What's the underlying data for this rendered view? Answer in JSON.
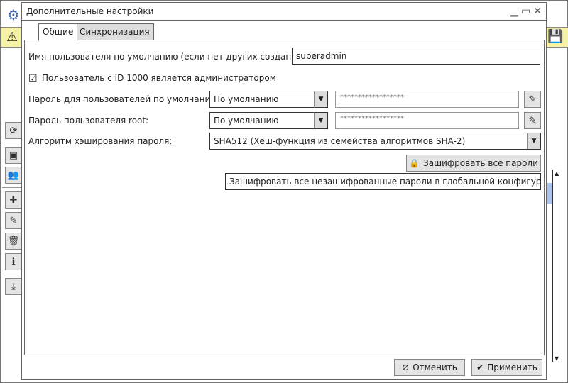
{
  "dialog": {
    "title": "Дополнительные настройки",
    "tabs": [
      {
        "label": "Общие",
        "active": true
      },
      {
        "label": "Синхронизация",
        "active": false
      }
    ],
    "default_user_label": "Имя пользователя по умолчанию (если нет других созданных):",
    "default_user_value": "superadmin",
    "admin_checkbox_label": "Пользователь с ID 1000 является администратором",
    "admin_checked": true,
    "default_password_label": "Пароль для пользователей по умолчанию:",
    "default_password_mode": "По умолчанию",
    "default_password_value": "******************",
    "root_password_label": "Пароль пользователя root:",
    "root_password_mode": "По умолчанию",
    "root_password_value": "******************",
    "hash_label": "Алгоритм хэширования пароля:",
    "hash_value": "SHA512 (Хеш-функция из семейства алгоритмов SHA-2)",
    "encrypt_button": "Зашифровать все пароли",
    "encrypt_tooltip": "Зашифровать все незашифрованные пароли в глобальной конфигурации",
    "cancel_button": "Отменить",
    "apply_button": "Применить"
  },
  "colors": {
    "warning_bar": "#f6f2a8",
    "scroll_thumb": "#a8c4ee"
  }
}
